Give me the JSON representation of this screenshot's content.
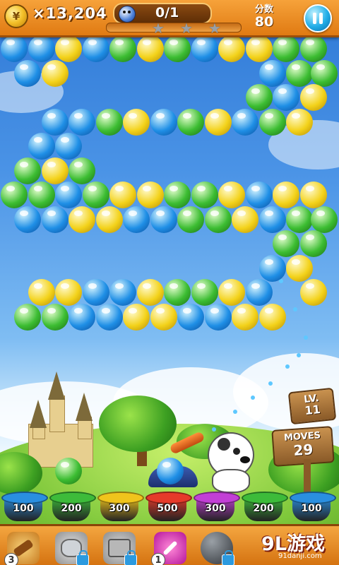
{
  "hud": {
    "coin_symbol": "¥",
    "coins": "×13,204",
    "goal": "0/1",
    "score_label": "分数",
    "score": "80"
  },
  "level": {
    "label": "LV.",
    "number": "11",
    "moves_label": "MOVES",
    "moves": "29"
  },
  "pots": [
    {
      "value": "100",
      "color": "#2a8fe0"
    },
    {
      "value": "200",
      "color": "#3dbb3a"
    },
    {
      "value": "300",
      "color": "#f0c41c"
    },
    {
      "value": "500",
      "color": "#e63a2a"
    },
    {
      "value": "300",
      "color": "#c23fd6"
    },
    {
      "value": "200",
      "color": "#3dbb3a"
    },
    {
      "value": "100",
      "color": "#2a8fe0"
    }
  ],
  "toolbar": {
    "hammer_count": "3",
    "line_count": "1",
    "brand": "9L游戏",
    "brand_url": "91danji.com"
  },
  "colors": {
    "blue": "#1f8fe6",
    "green": "#3cbd32",
    "yellow": "#f3d21a"
  },
  "bubble_rows": [
    {
      "row": 0,
      "offset": false,
      "cells": [
        "B",
        "B",
        "Y",
        "B",
        "G",
        "Y",
        "G",
        "B",
        "Y",
        "Y",
        "G",
        "G"
      ]
    },
    {
      "row": 1,
      "offset": true,
      "cells": [
        "B",
        "Y",
        "",
        "",
        "",
        "",
        "",
        "",
        "",
        "B",
        "G",
        "G"
      ]
    },
    {
      "row": 2,
      "offset": false,
      "cells": [
        "",
        "",
        "",
        "",
        "",
        "",
        "",
        "",
        "",
        "G",
        "B",
        "Y"
      ]
    },
    {
      "row": 3,
      "offset": true,
      "cells": [
        "",
        "B",
        "B",
        "G",
        "Y",
        "B",
        "G",
        "Y",
        "B",
        "G",
        "Y",
        ""
      ]
    },
    {
      "row": 4,
      "offset": false,
      "cells": [
        "",
        "B",
        "B",
        "",
        "",
        "",
        "",
        "",
        "",
        "",
        "",
        ""
      ]
    },
    {
      "row": 5,
      "offset": true,
      "cells": [
        "G",
        "Y",
        "G",
        "",
        "",
        "",
        "",
        "",
        "",
        "",
        "",
        ""
      ]
    },
    {
      "row": 6,
      "offset": false,
      "cells": [
        "G",
        "G",
        "B",
        "G",
        "Y",
        "Y",
        "G",
        "G",
        "Y",
        "B",
        "Y",
        "Y"
      ]
    },
    {
      "row": 7,
      "offset": true,
      "cells": [
        "B",
        "B",
        "Y",
        "Y",
        "B",
        "B",
        "G",
        "G",
        "Y",
        "B",
        "G",
        "G"
      ]
    },
    {
      "row": 8,
      "offset": false,
      "cells": [
        "",
        "",
        "",
        "",
        "",
        "",
        "",
        "",
        "",
        "",
        "G",
        "G"
      ]
    },
    {
      "row": 9,
      "offset": true,
      "cells": [
        "",
        "",
        "",
        "",
        "",
        "",
        "",
        "",
        "",
        "B",
        "Y",
        ""
      ]
    },
    {
      "row": 10,
      "offset": false,
      "cells": [
        "",
        "Y",
        "Y",
        "B",
        "B",
        "Y",
        "G",
        "G",
        "Y",
        "B",
        "",
        "Y"
      ]
    },
    {
      "row": 11,
      "offset": true,
      "cells": [
        "G",
        "G",
        "B",
        "B",
        "Y",
        "Y",
        "B",
        "B",
        "Y",
        "Y",
        "",
        ""
      ]
    }
  ],
  "shooter": {
    "loaded": "B",
    "next": "G"
  }
}
